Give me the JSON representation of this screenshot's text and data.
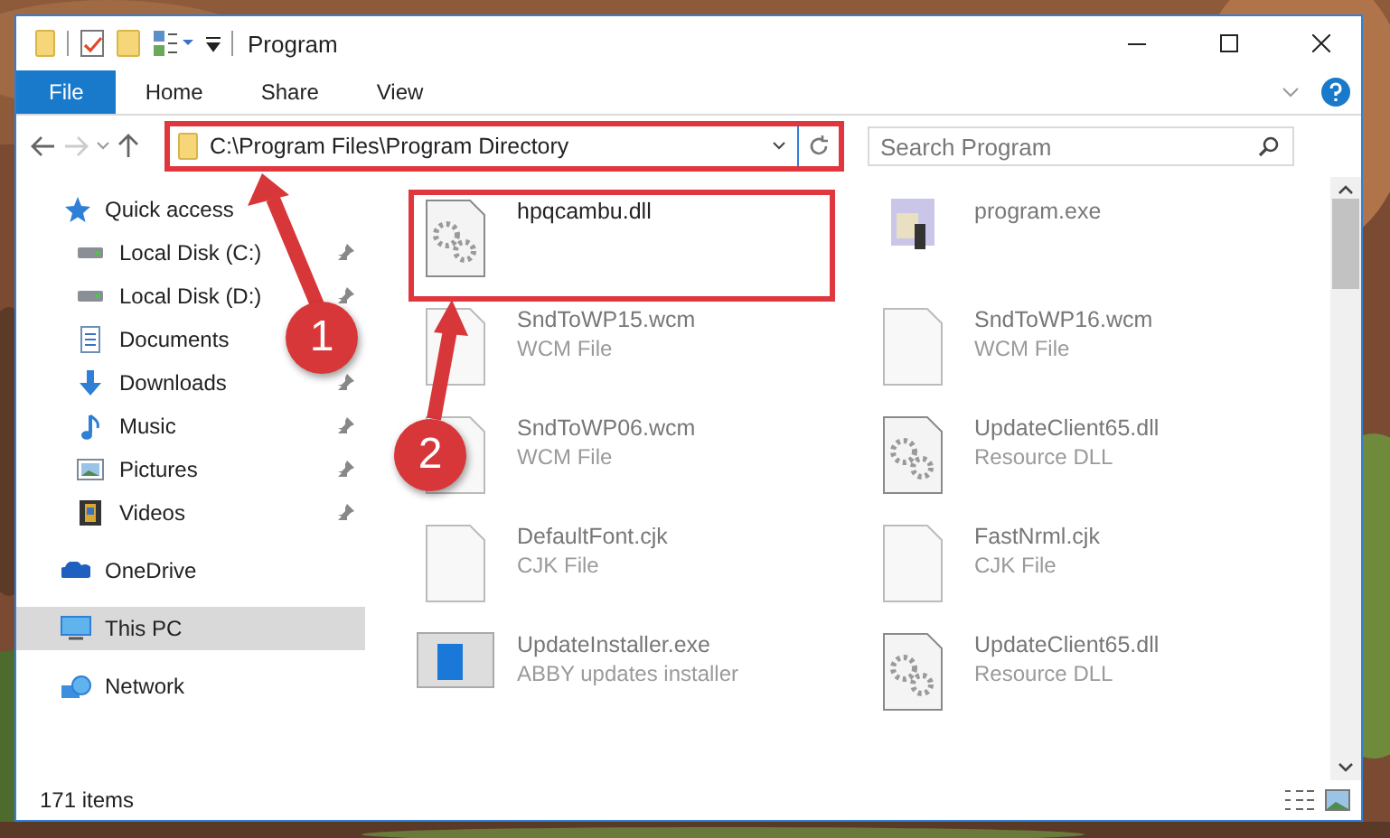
{
  "window": {
    "title": "Program"
  },
  "quick_access_toolbar": [
    {
      "kind": "folder"
    },
    {
      "kind": "properties"
    },
    {
      "kind": "newfolder"
    },
    {
      "kind": "layout"
    }
  ],
  "ribbon_tabs": [
    {
      "label": "File",
      "selected": true
    },
    {
      "label": "Home",
      "selected": false
    },
    {
      "label": "Share",
      "selected": false
    },
    {
      "label": "View",
      "selected": false
    }
  ],
  "address_bar": {
    "path": "C:\\Program Files\\Program Directory",
    "marked": true
  },
  "search": {
    "placeholder": "Search Program"
  },
  "sidebar": {
    "items": [
      {
        "label": "Quick access",
        "kind": "star",
        "selected": false,
        "pinned": false,
        "children": [
          {
            "label": "Local Disk (C:)",
            "kind": "disk",
            "selected": false,
            "pinned": true
          },
          {
            "label": "Local Disk (D:)",
            "kind": "disk",
            "selected": false,
            "pinned": true
          },
          {
            "label": "Documents",
            "kind": "documents",
            "selected": false,
            "pinned": false
          },
          {
            "label": "Downloads",
            "kind": "downloads",
            "selected": false,
            "pinned": true
          },
          {
            "label": "Music",
            "kind": "music",
            "selected": false,
            "pinned": true
          },
          {
            "label": "Pictures",
            "kind": "pictures",
            "selected": false,
            "pinned": true
          },
          {
            "label": "Videos",
            "kind": "videos",
            "selected": false,
            "pinned": true
          }
        ]
      },
      {
        "label": "OneDrive",
        "kind": "cloud",
        "selected": false,
        "pinned": false
      },
      {
        "label": "This PC",
        "kind": "pc",
        "selected": true,
        "pinned": false
      },
      {
        "label": "Network",
        "kind": "network",
        "selected": false,
        "pinned": false
      }
    ]
  },
  "files": [
    {
      "name": "hpqcambu.dll",
      "kind": "dll",
      "blurred": false,
      "marked": true
    },
    {
      "name": "program.exe",
      "kind": "exe",
      "blurred": true,
      "marked": false
    },
    {
      "name": "SndToWP15.wcm",
      "type": "WCM File",
      "kind": "file",
      "blurred": true,
      "marked": false
    },
    {
      "name": "SndToWP16.wcm",
      "type": "WCM File",
      "kind": "file",
      "blurred": true,
      "marked": false
    },
    {
      "name": "SndToWP06.wcm",
      "type": "WCM File",
      "kind": "file",
      "blurred": true,
      "marked": false
    },
    {
      "name": "UpdateClient65.dll",
      "type": "Resource DLL",
      "kind": "dll",
      "blurred": true,
      "marked": false
    },
    {
      "name": "DefaultFont.cjk",
      "type": "CJK File",
      "kind": "file",
      "blurred": true,
      "marked": false
    },
    {
      "name": "FastNrml.cjk",
      "type": "CJK File",
      "kind": "file",
      "blurred": true,
      "marked": false
    },
    {
      "name": "UpdateInstaller.exe",
      "type": "ABBY updates installer",
      "kind": "installer",
      "blurred": true,
      "marked": false
    },
    {
      "name": "UpdateClient65.dll",
      "type": "Resource DLL",
      "kind": "dll",
      "blurred": true,
      "marked": false
    }
  ],
  "status_bar": {
    "item_count": "171 items"
  },
  "annotations": [
    {
      "label": "1"
    },
    {
      "label": "2"
    }
  ]
}
